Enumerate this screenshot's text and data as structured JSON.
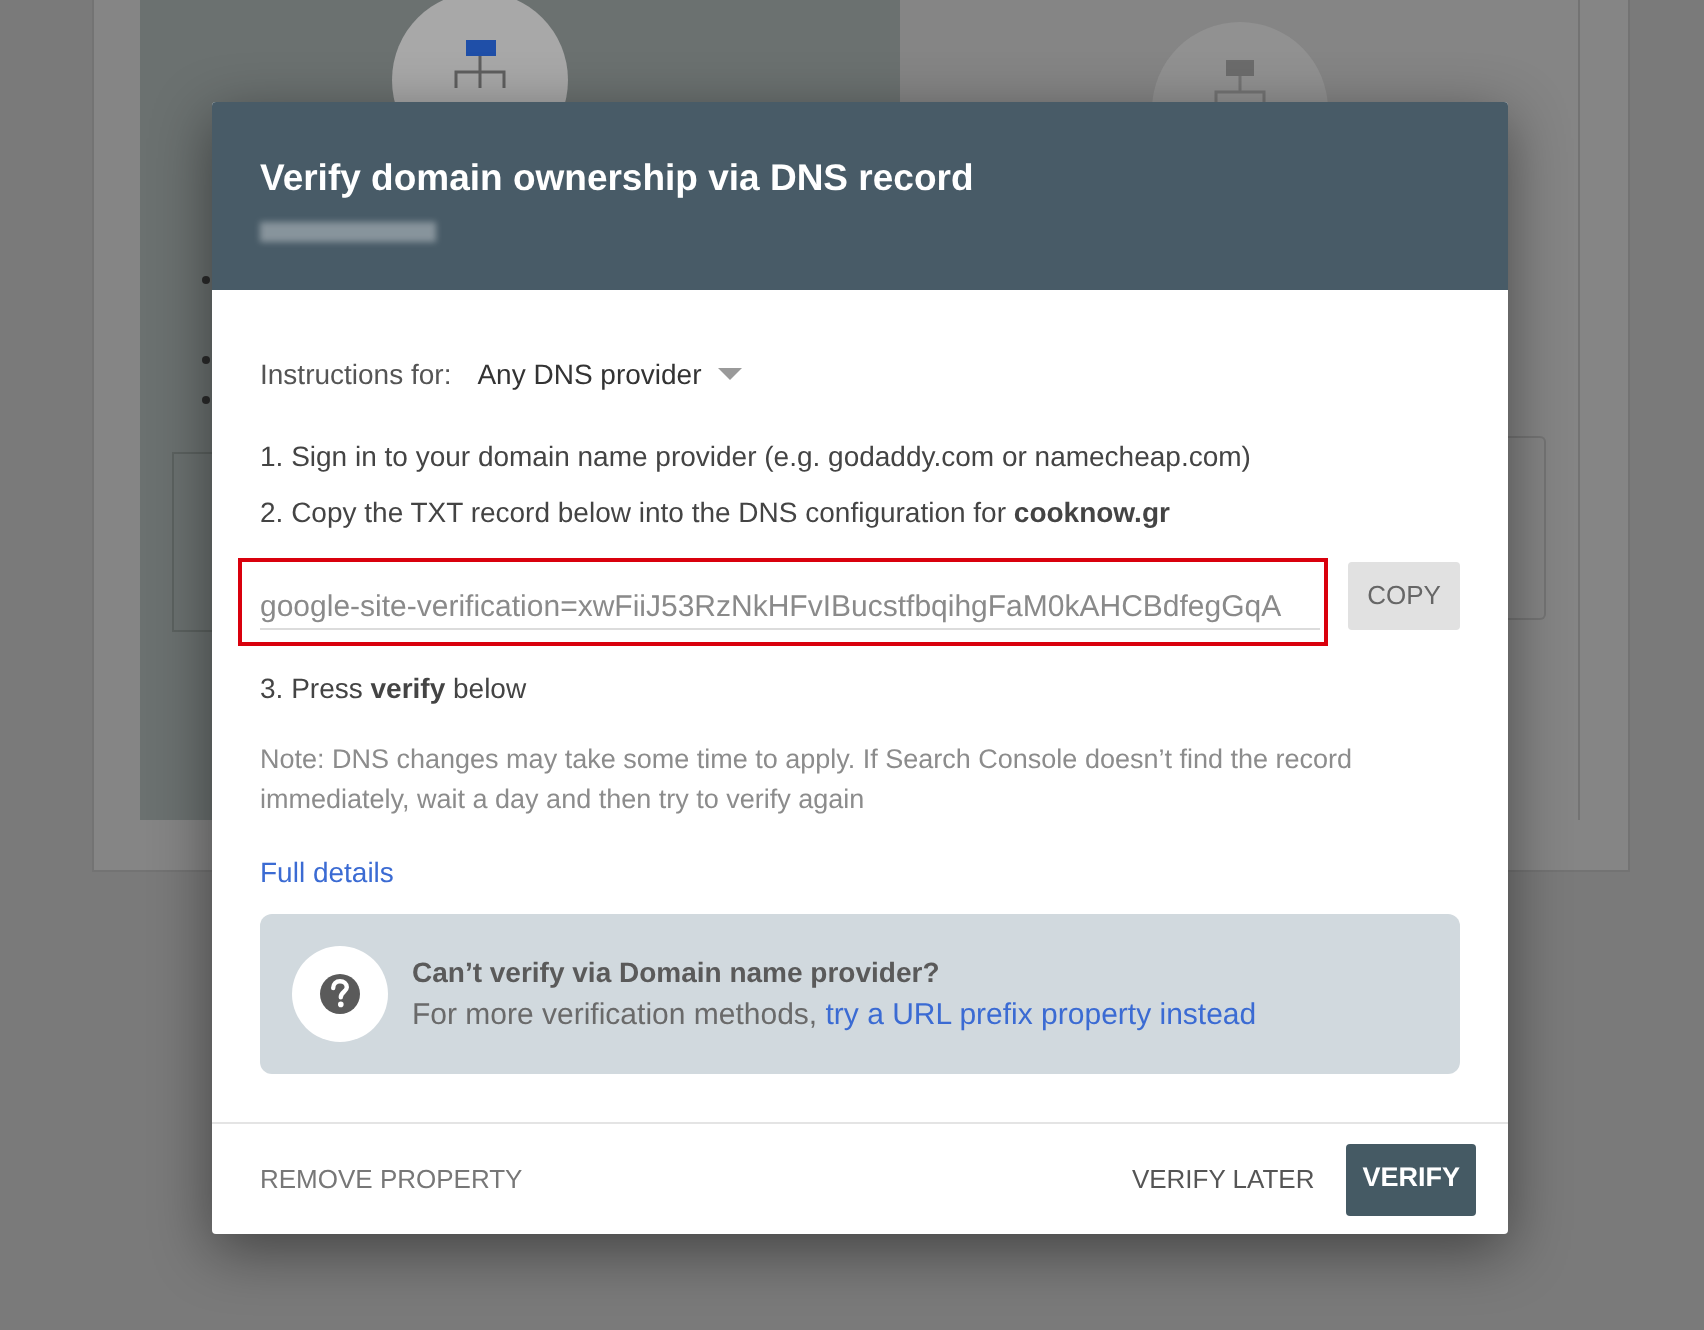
{
  "background": {
    "option_cards": [
      {
        "selected": true
      },
      {
        "selected": false
      }
    ]
  },
  "dialog": {
    "title": "Verify domain ownership via DNS record",
    "instructions_label": "Instructions for:",
    "provider_dropdown": {
      "value": "Any DNS provider"
    },
    "steps": [
      "1. Sign in to your domain name provider (e.g. godaddy.com or namecheap.com)",
      "2. Copy the TXT record below into the DNS configuration for **cooknow.gr**"
    ],
    "record_field": {
      "value": "google-site-verification=xwFiiJ53RzNkHFvIBucstfbqihgFaM0kAHCBdfegGqA",
      "highlighted": true
    },
    "copy_button": "COPY",
    "final_step": "3. Press **verify** below",
    "note": "Note: DNS changes may take some time to apply. If Search Console doesn’t find the record immediately, wait a day and then try to verify again",
    "details_link": "Full details",
    "help_box": {
      "title": "Can’t verify via Domain name provider?",
      "text": "For more verification methods, ",
      "link": "try a URL prefix property instead"
    },
    "footer": {
      "remove_button": "REMOVE PROPERTY",
      "later_button": "VERIFY LATER",
      "verify_button": "VERIFY"
    }
  }
}
